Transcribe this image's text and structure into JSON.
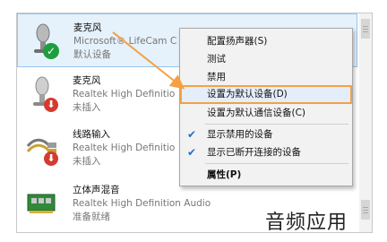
{
  "devices": [
    {
      "name": "麦克风",
      "description": "Microsoft® LifeCam C",
      "status": "默认设备",
      "icon": "microphone-icon",
      "badge": "default-check-badge-icon"
    },
    {
      "name": "麦克风",
      "description": "Realtek High Definitio",
      "status": "未插入",
      "icon": "microphone-icon",
      "badge": "unplugged-badge-icon"
    },
    {
      "name": "线路输入",
      "description": "Realtek High Definitio",
      "status": "未插入",
      "icon": "line-in-cable-icon",
      "badge": "unplugged-badge-icon"
    },
    {
      "name": "立体声混音",
      "description": "Realtek High Definition Audio",
      "status": "准备就绪",
      "icon": "sound-card-icon",
      "badge": ""
    }
  ],
  "context_menu": {
    "items": [
      {
        "label": "配置扬声器(S)"
      },
      {
        "label": "测试"
      },
      {
        "label": "禁用"
      },
      {
        "label": "设置为默认设备(D)",
        "highlighted": true
      },
      {
        "label": "设置为默认通信设备(C)"
      },
      {
        "label": "显示禁用的设备",
        "checked": true
      },
      {
        "label": "显示已断开连接的设备",
        "checked": true
      },
      {
        "label": "属性(P)",
        "bold": true
      }
    ]
  },
  "caption": "音频应用",
  "colors": {
    "accent_orange": "#f5a143",
    "check_blue": "#1f6fd1",
    "badge_green": "#1e9e3e",
    "badge_red": "#d43b2f"
  }
}
